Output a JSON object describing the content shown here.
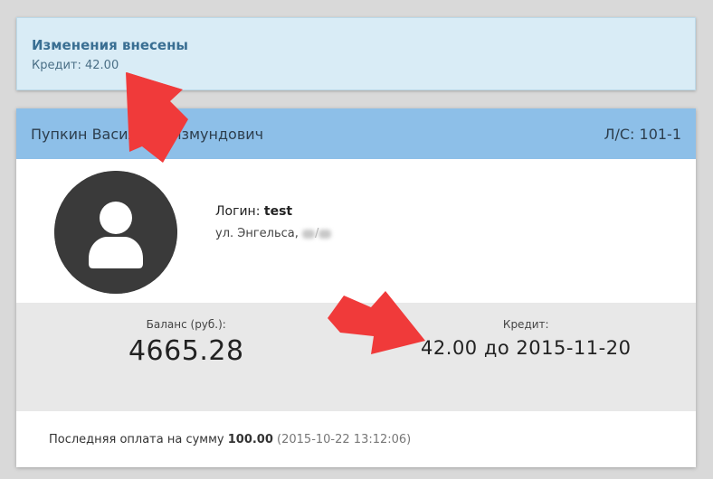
{
  "alert": {
    "title": "Изменения внесены",
    "text": "Кредит: 42.00"
  },
  "card": {
    "header": {
      "name": "Пупкин Василий Олзмундович",
      "account": "Л/С: 101-1"
    },
    "user": {
      "avatar_icon": "user-icon",
      "login_label": "Логин:",
      "login_value": "test",
      "address_prefix": "ул. Энгельса,",
      "address_sep": "/"
    },
    "stats": {
      "balance_label": "Баланс (руб.):",
      "balance_value": "4665.28",
      "credit_label": "Кредит:",
      "credit_value": "42.00 до 2015-11-20"
    },
    "footer": {
      "prefix": "Последняя оплата на сумму",
      "amount": "100.00",
      "date": "(2015-10-22 13:12:06)"
    }
  },
  "colors": {
    "background": "#d9d9d9",
    "alert_bg": "#d9ecf6",
    "alert_title": "#3a6f93",
    "header_bg": "#8dbfe8",
    "stats_bg": "#e8e8e8",
    "annotation_arrow": "#f03a3a"
  }
}
